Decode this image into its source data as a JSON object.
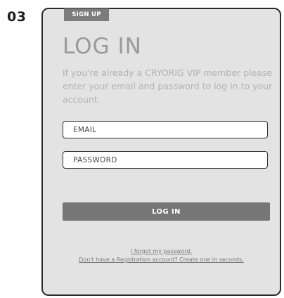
{
  "step_number": "03",
  "card": {
    "signup_tab": "SIGN UP",
    "title": "LOG IN",
    "description": "If you're already a CRYORIG VIP member please enter your email and password to log in to your account.",
    "email_placeholder": "EMAIL",
    "password_placeholder": "PASSWORD",
    "login_button": "LOG IN",
    "forgot_link": "I forgot my password.",
    "register_link": "Don't have a Registration account? Create one in seconds."
  },
  "colors": {
    "card_bg": "#e3e3e3",
    "button_bg": "#767676",
    "tab_bg": "#7c7c7c",
    "border": "#2a2a2a"
  }
}
